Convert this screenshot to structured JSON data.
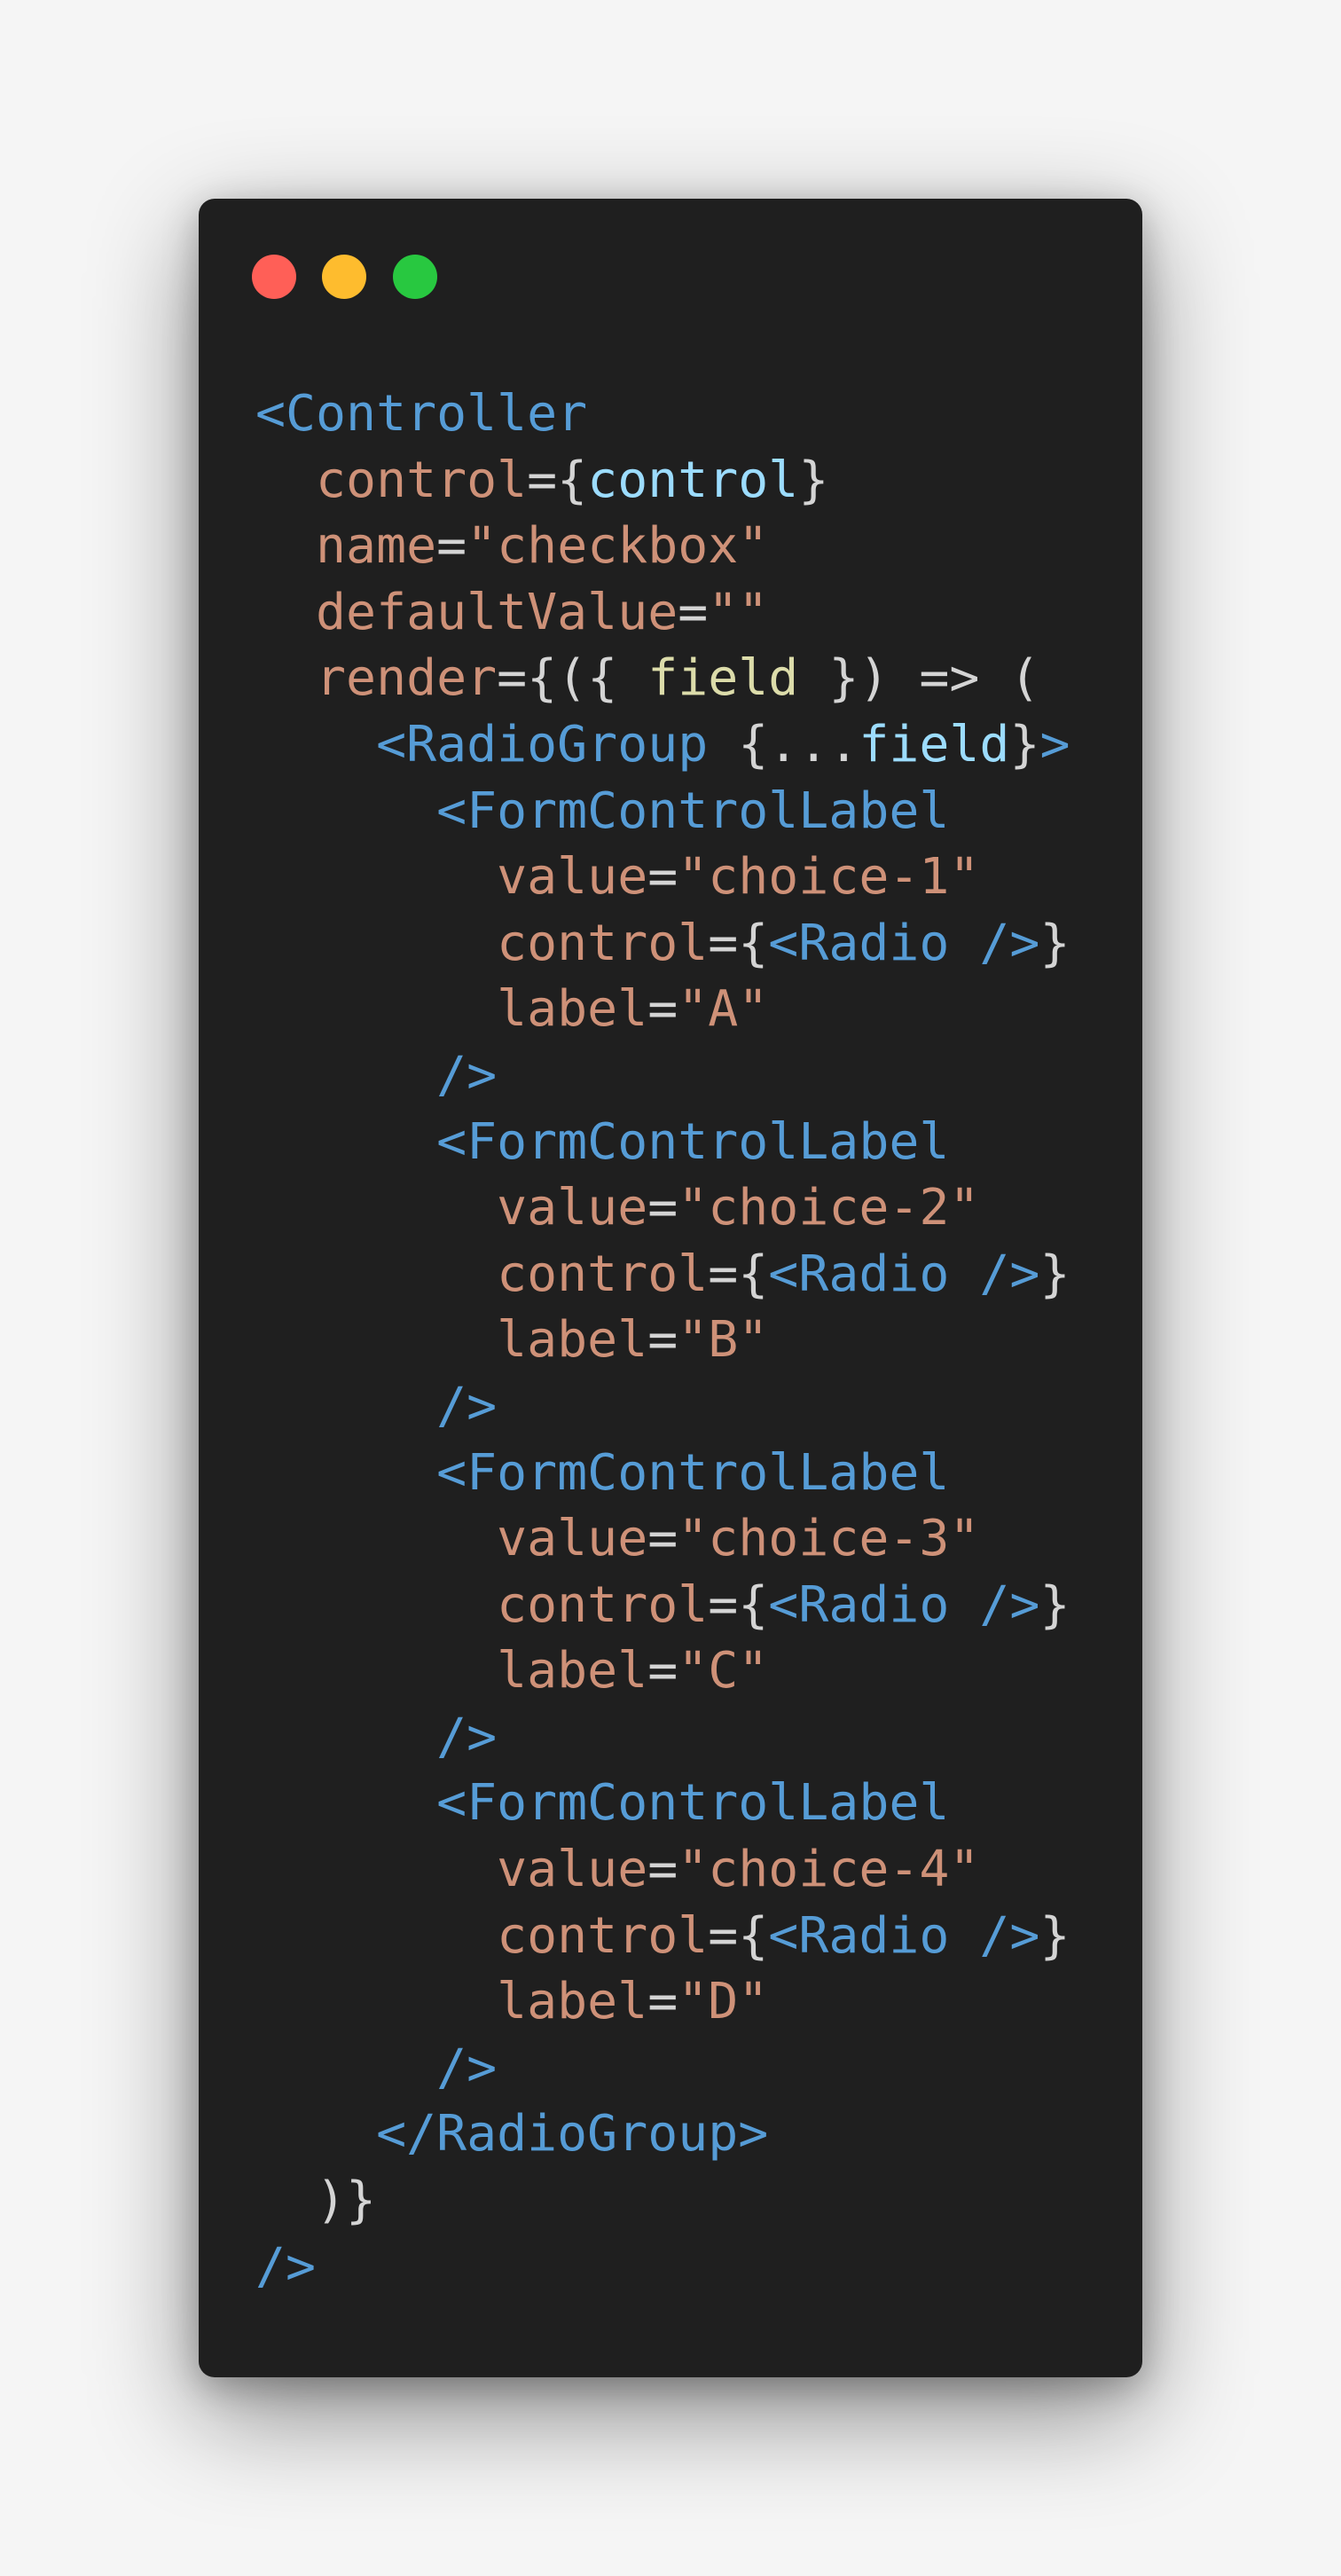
{
  "window_controls": {
    "close_color": "#ff5f57",
    "minimize_color": "#febc2e",
    "maximize_color": "#28c840"
  },
  "colors": {
    "background": "#f5f5f5",
    "editor_background": "#1f1f1f",
    "tag": "#569cd6",
    "attribute": "#ce9178",
    "string": "#ce9178",
    "punctuation": "#d4d4d4",
    "variable": "#9cdcfe",
    "parameter": "#dcdcaa"
  },
  "code": {
    "lines": [
      [
        {
          "t": "<Controller",
          "c": "tag"
        }
      ],
      [
        {
          "t": "  control",
          "c": "attr"
        },
        {
          "t": "={",
          "c": "punc"
        },
        {
          "t": "control",
          "c": "var"
        },
        {
          "t": "}",
          "c": "punc"
        }
      ],
      [
        {
          "t": "  name",
          "c": "attr"
        },
        {
          "t": "=",
          "c": "punc"
        },
        {
          "t": "\"checkbox\"",
          "c": "str"
        }
      ],
      [
        {
          "t": "  defaultValue",
          "c": "attr"
        },
        {
          "t": "=",
          "c": "punc"
        },
        {
          "t": "\"\"",
          "c": "str"
        }
      ],
      [
        {
          "t": "  render",
          "c": "attr"
        },
        {
          "t": "={({ ",
          "c": "punc"
        },
        {
          "t": "field",
          "c": "param"
        },
        {
          "t": " }) => (",
          "c": "punc"
        }
      ],
      [
        {
          "t": "    <RadioGroup ",
          "c": "tag"
        },
        {
          "t": "{...",
          "c": "punc"
        },
        {
          "t": "field",
          "c": "var"
        },
        {
          "t": "}",
          "c": "punc"
        },
        {
          "t": ">",
          "c": "tag"
        }
      ],
      [
        {
          "t": "      <FormControlLabel",
          "c": "tag"
        }
      ],
      [
        {
          "t": "        value",
          "c": "attr"
        },
        {
          "t": "=",
          "c": "punc"
        },
        {
          "t": "\"choice-1\"",
          "c": "str"
        }
      ],
      [
        {
          "t": "        control",
          "c": "attr"
        },
        {
          "t": "={",
          "c": "punc"
        },
        {
          "t": "<Radio />",
          "c": "tag"
        },
        {
          "t": "}",
          "c": "punc"
        }
      ],
      [
        {
          "t": "        label",
          "c": "attr"
        },
        {
          "t": "=",
          "c": "punc"
        },
        {
          "t": "\"A\"",
          "c": "str"
        }
      ],
      [
        {
          "t": "      />",
          "c": "tag"
        }
      ],
      [
        {
          "t": "      <FormControlLabel",
          "c": "tag"
        }
      ],
      [
        {
          "t": "        value",
          "c": "attr"
        },
        {
          "t": "=",
          "c": "punc"
        },
        {
          "t": "\"choice-2\"",
          "c": "str"
        }
      ],
      [
        {
          "t": "        control",
          "c": "attr"
        },
        {
          "t": "={",
          "c": "punc"
        },
        {
          "t": "<Radio />",
          "c": "tag"
        },
        {
          "t": "}",
          "c": "punc"
        }
      ],
      [
        {
          "t": "        label",
          "c": "attr"
        },
        {
          "t": "=",
          "c": "punc"
        },
        {
          "t": "\"B\"",
          "c": "str"
        }
      ],
      [
        {
          "t": "      />",
          "c": "tag"
        }
      ],
      [
        {
          "t": "      <FormControlLabel",
          "c": "tag"
        }
      ],
      [
        {
          "t": "        value",
          "c": "attr"
        },
        {
          "t": "=",
          "c": "punc"
        },
        {
          "t": "\"choice-3\"",
          "c": "str"
        }
      ],
      [
        {
          "t": "        control",
          "c": "attr"
        },
        {
          "t": "={",
          "c": "punc"
        },
        {
          "t": "<Radio />",
          "c": "tag"
        },
        {
          "t": "}",
          "c": "punc"
        }
      ],
      [
        {
          "t": "        label",
          "c": "attr"
        },
        {
          "t": "=",
          "c": "punc"
        },
        {
          "t": "\"C\"",
          "c": "str"
        }
      ],
      [
        {
          "t": "      />",
          "c": "tag"
        }
      ],
      [
        {
          "t": "      <FormControlLabel",
          "c": "tag"
        }
      ],
      [
        {
          "t": "        value",
          "c": "attr"
        },
        {
          "t": "=",
          "c": "punc"
        },
        {
          "t": "\"choice-4\"",
          "c": "str"
        }
      ],
      [
        {
          "t": "        control",
          "c": "attr"
        },
        {
          "t": "={",
          "c": "punc"
        },
        {
          "t": "<Radio />",
          "c": "tag"
        },
        {
          "t": "}",
          "c": "punc"
        }
      ],
      [
        {
          "t": "        label",
          "c": "attr"
        },
        {
          "t": "=",
          "c": "punc"
        },
        {
          "t": "\"D\"",
          "c": "str"
        }
      ],
      [
        {
          "t": "      />",
          "c": "tag"
        }
      ],
      [
        {
          "t": "    </RadioGroup>",
          "c": "tag"
        }
      ],
      [
        {
          "t": "  )}",
          "c": "punc"
        }
      ],
      [
        {
          "t": "/>",
          "c": "tag"
        }
      ]
    ]
  }
}
